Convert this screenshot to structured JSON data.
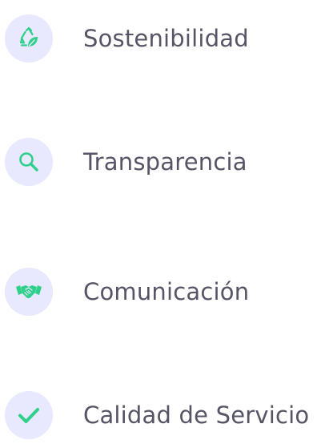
{
  "values": {
    "accent_color": "#2fd08a",
    "badge_color": "#e8e8ff",
    "items": [
      {
        "label": "Sostenibilidad",
        "icon": "recycle-leaf-icon"
      },
      {
        "label": "Transparencia",
        "icon": "search-icon"
      },
      {
        "label": "Comunicación",
        "icon": "handshake-icon"
      },
      {
        "label": "Calidad de Servicio",
        "icon": "checkmark-icon"
      }
    ]
  }
}
